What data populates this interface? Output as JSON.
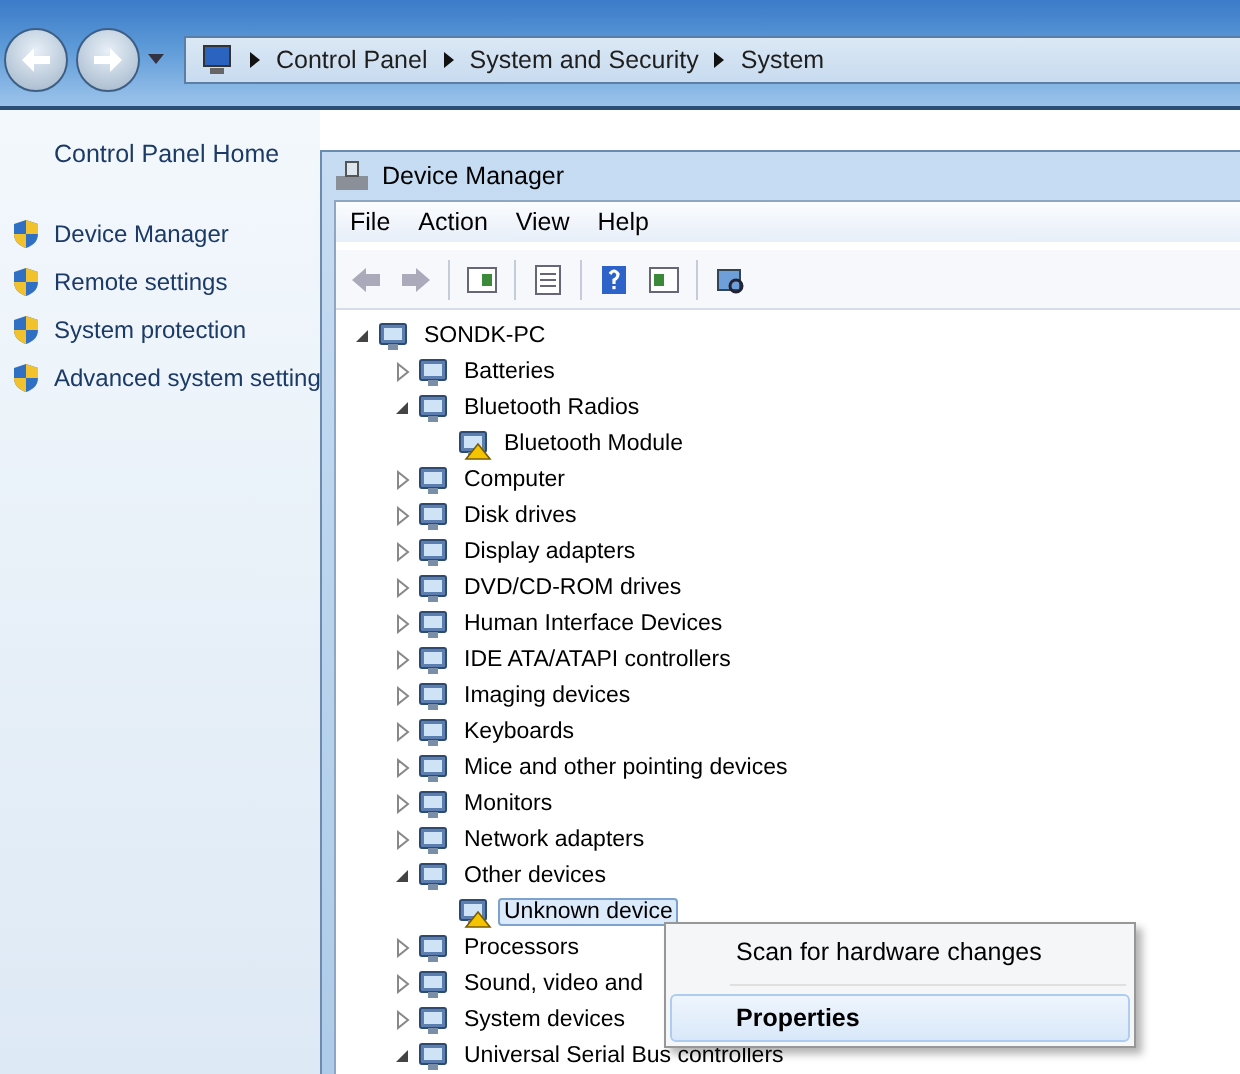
{
  "address_bar": {
    "crumbs": [
      "Control Panel",
      "System and Security",
      "System"
    ]
  },
  "left_pane": {
    "home_link": "Control Panel Home",
    "tasks": [
      "Device Manager",
      "Remote settings",
      "System protection",
      "Advanced system setting"
    ]
  },
  "window": {
    "title": "Device Manager",
    "menu": [
      "File",
      "Action",
      "View",
      "Help"
    ],
    "tree": {
      "label": "SONDK-PC",
      "expanded": true,
      "selected": false,
      "warning": false,
      "children": [
        {
          "label": "Batteries",
          "expanded": false,
          "selected": false,
          "warning": false
        },
        {
          "label": "Bluetooth Radios",
          "expanded": true,
          "selected": false,
          "warning": false,
          "children": [
            {
              "label": "Bluetooth Module",
              "selected": false,
              "warning": true
            }
          ]
        },
        {
          "label": "Computer",
          "expanded": false,
          "selected": false,
          "warning": false
        },
        {
          "label": "Disk drives",
          "expanded": false,
          "selected": false,
          "warning": false
        },
        {
          "label": "Display adapters",
          "expanded": false,
          "selected": false,
          "warning": false
        },
        {
          "label": "DVD/CD-ROM drives",
          "expanded": false,
          "selected": false,
          "warning": false
        },
        {
          "label": "Human Interface Devices",
          "expanded": false,
          "selected": false,
          "warning": false
        },
        {
          "label": "IDE ATA/ATAPI controllers",
          "expanded": false,
          "selected": false,
          "warning": false
        },
        {
          "label": "Imaging devices",
          "expanded": false,
          "selected": false,
          "warning": false
        },
        {
          "label": "Keyboards",
          "expanded": false,
          "selected": false,
          "warning": false
        },
        {
          "label": "Mice and other pointing devices",
          "expanded": false,
          "selected": false,
          "warning": false
        },
        {
          "label": "Monitors",
          "expanded": false,
          "selected": false,
          "warning": false
        },
        {
          "label": "Network adapters",
          "expanded": false,
          "selected": false,
          "warning": false
        },
        {
          "label": "Other devices",
          "expanded": true,
          "selected": false,
          "warning": false,
          "children": [
            {
              "label": "Unknown device",
              "selected": true,
              "warning": true
            }
          ]
        },
        {
          "label": "Processors",
          "expanded": false,
          "selected": false,
          "warning": false
        },
        {
          "label": "Sound, video and",
          "expanded": false,
          "selected": false,
          "warning": false
        },
        {
          "label": "System devices",
          "expanded": false,
          "selected": false,
          "warning": false
        },
        {
          "label": "Universal Serial Bus controllers",
          "expanded": true,
          "selected": false,
          "warning": false
        }
      ]
    },
    "context_menu": {
      "items": [
        {
          "label": "Scan for hardware changes",
          "selected": false,
          "default": false
        },
        {
          "label": "Properties",
          "selected": true,
          "default": true
        }
      ]
    }
  }
}
